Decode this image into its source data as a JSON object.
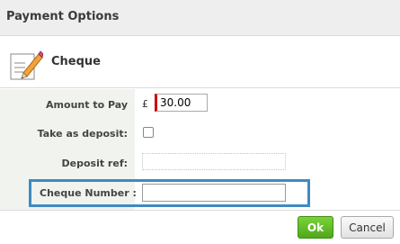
{
  "dialog": {
    "title": "Payment Options"
  },
  "section": {
    "title": "Cheque",
    "icon": "cheque-pencil-icon"
  },
  "form": {
    "amount": {
      "label": "Amount to Pay",
      "currency": "£",
      "value": "30.00"
    },
    "deposit": {
      "label": "Take as deposit:",
      "checked": false
    },
    "deposit_ref": {
      "label": "Deposit ref:",
      "value": ""
    },
    "cheque_number": {
      "label": "Cheque Number :",
      "value": ""
    }
  },
  "buttons": {
    "ok_label": "Ok",
    "cancel_label": "Cancel"
  },
  "colors": {
    "ok": "#5cb82a",
    "highlight": "#3f8ac2",
    "required": "#cc0000",
    "label_bg": "#f0f3ee"
  }
}
